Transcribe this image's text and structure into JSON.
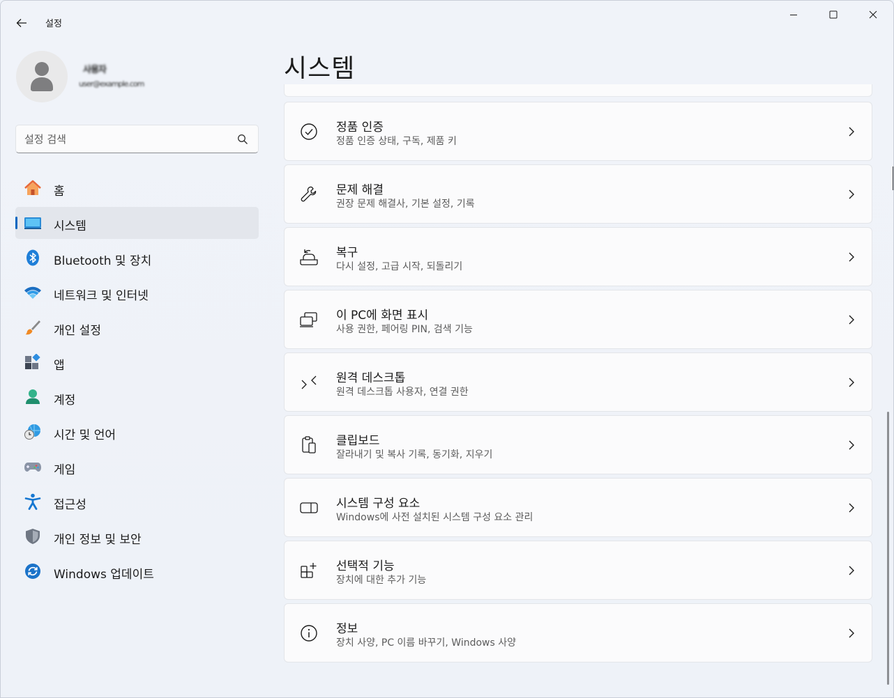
{
  "app": {
    "title": "설정"
  },
  "profile": {
    "name": "사용자",
    "email": "user@example.com"
  },
  "search": {
    "placeholder": "설정 검색"
  },
  "sidebar": {
    "items": [
      {
        "label": "홈",
        "icon": "home-icon"
      },
      {
        "label": "시스템",
        "icon": "system-icon",
        "selected": true
      },
      {
        "label": "Bluetooth 및 장치",
        "icon": "bluetooth-icon"
      },
      {
        "label": "네트워크 및 인터넷",
        "icon": "wifi-icon"
      },
      {
        "label": "개인 설정",
        "icon": "brush-icon"
      },
      {
        "label": "앱",
        "icon": "apps-icon"
      },
      {
        "label": "계정",
        "icon": "account-icon"
      },
      {
        "label": "시간 및 언어",
        "icon": "time-language-icon"
      },
      {
        "label": "게임",
        "icon": "gamepad-icon"
      },
      {
        "label": "접근성",
        "icon": "accessibility-icon"
      },
      {
        "label": "개인 정보 및 보안",
        "icon": "shield-icon"
      },
      {
        "label": "Windows 업데이트",
        "icon": "update-icon"
      }
    ]
  },
  "main": {
    "title": "시스템",
    "cards": [
      {
        "title": "정품 인증",
        "subtitle": "정품 인증 상태, 구독, 제품 키",
        "icon": "activation-check-icon"
      },
      {
        "title": "문제 해결",
        "subtitle": "권장 문제 해결사, 기본 설정, 기록",
        "icon": "wrench-icon"
      },
      {
        "title": "복구",
        "subtitle": "다시 설정, 고급 시작, 되돌리기",
        "icon": "recovery-icon"
      },
      {
        "title": "이 PC에 화면 표시",
        "subtitle": "사용 권한, 페어링 PIN, 검색 기능",
        "icon": "project-to-pc-icon"
      },
      {
        "title": "원격 데스크톱",
        "subtitle": "원격 데스크톱 사용자, 연결 권한",
        "icon": "remote-desktop-icon"
      },
      {
        "title": "클립보드",
        "subtitle": "잘라내기 및 복사 기록, 동기화, 지우기",
        "icon": "clipboard-icon"
      },
      {
        "title": "시스템 구성 요소",
        "subtitle": "Windows에 사전 설치된 시스템 구성 요소 관리",
        "icon": "system-components-icon"
      },
      {
        "title": "선택적 기능",
        "subtitle": "장치에 대한 추가 기능",
        "icon": "optional-features-icon"
      },
      {
        "title": "정보",
        "subtitle": "장치 사양, PC 이름 바꾸기, Windows 사양",
        "icon": "info-icon"
      }
    ]
  },
  "colors": {
    "accent": "#0067c0",
    "background": "#eef2f9",
    "card": "#fbfbfc"
  }
}
